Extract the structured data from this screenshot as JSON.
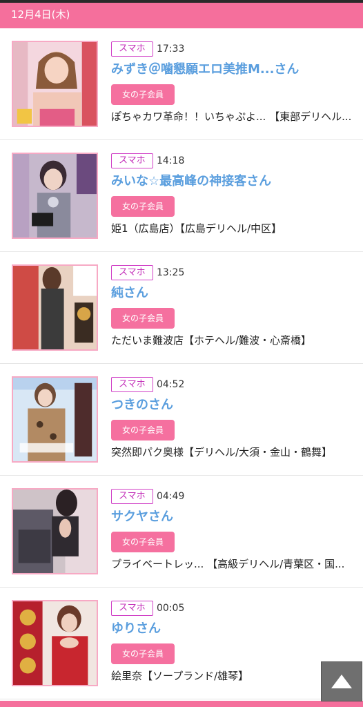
{
  "header": {
    "date": "12月4日(木)"
  },
  "entries": [
    {
      "badge": "スマホ",
      "time": "17:33",
      "name": "みずき＠噛懇願エロ美推M...さん",
      "member_button": "女の子会員",
      "shop": "ぽちゃカワ革命！！いちゃぷよ... 【東部デリヘル..."
    },
    {
      "badge": "スマホ",
      "time": "14:18",
      "name": "みいな☆最高峰の神接客さん",
      "member_button": "女の子会員",
      "shop": "姫1（広島店）【広島デリヘル/中区】"
    },
    {
      "badge": "スマホ",
      "time": "13:25",
      "name": "純さん",
      "member_button": "女の子会員",
      "shop": "ただいま難波店【ホテヘル/難波・心斎橋】"
    },
    {
      "badge": "スマホ",
      "time": "04:52",
      "name": "つきのさん",
      "member_button": "女の子会員",
      "shop": "突然即パク奥様【デリヘル/大須・金山・鶴舞】"
    },
    {
      "badge": "スマホ",
      "time": "04:49",
      "name": "サクヤさん",
      "member_button": "女の子会員",
      "shop": "プライベートレッ... 【高級デリヘル/青葉区・国..."
    },
    {
      "badge": "スマホ",
      "time": "00:05",
      "name": "ゆりさん",
      "member_button": "女の子会員",
      "shop": "絵里奈【ソープランド/雄琴】"
    }
  ],
  "scroll_top": {
    "icon": "triangle-up-icon"
  },
  "colors": {
    "accent_pink": "#f56f9c",
    "name_blue": "#5a9ede",
    "badge_magenta": "#c32fb9"
  }
}
